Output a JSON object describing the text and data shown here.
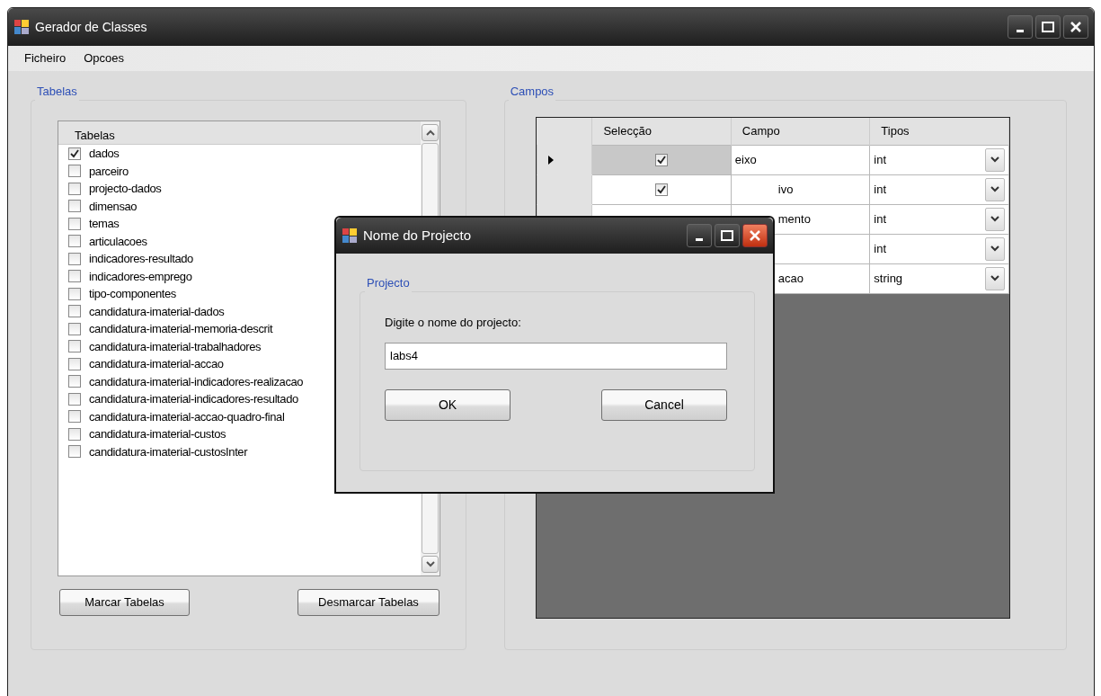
{
  "window": {
    "title": "Gerador de Classes"
  },
  "menu": [
    "Ficheiro",
    "Opcoes"
  ],
  "tables_group": {
    "title": "Tabelas",
    "header": "Tabelas",
    "items": [
      {
        "label": "dados",
        "checked": true
      },
      {
        "label": "parceiro",
        "checked": false
      },
      {
        "label": "projecto-dados",
        "checked": false
      },
      {
        "label": "dimensao",
        "checked": false
      },
      {
        "label": "temas",
        "checked": false
      },
      {
        "label": "articulacoes",
        "checked": false
      },
      {
        "label": "indicadores-resultado",
        "checked": false
      },
      {
        "label": "indicadores-emprego",
        "checked": false
      },
      {
        "label": "tipo-componentes",
        "checked": false
      },
      {
        "label": "candidatura-imaterial-dados",
        "checked": false
      },
      {
        "label": "candidatura-imaterial-memoria-descrit",
        "checked": false
      },
      {
        "label": "candidatura-imaterial-trabalhadores",
        "checked": false
      },
      {
        "label": "candidatura-imaterial-accao",
        "checked": false
      },
      {
        "label": "candidatura-imaterial-indicadores-realizacao",
        "checked": false
      },
      {
        "label": "candidatura-imaterial-indicadores-resultado",
        "checked": false
      },
      {
        "label": "candidatura-imaterial-accao-quadro-final",
        "checked": false
      },
      {
        "label": "candidatura-imaterial-custos",
        "checked": false
      },
      {
        "label": "candidatura-imaterial-custosInter",
        "checked": false
      }
    ],
    "buttons": [
      "Marcar Tabelas",
      "Desmarcar Tabelas"
    ]
  },
  "fields_group": {
    "title": "Campos",
    "columns": [
      "Selecção",
      "Campo",
      "Tipos"
    ],
    "rows": [
      {
        "current": true,
        "checked": true,
        "campo": "eixo",
        "tipo": "int",
        "covered": false
      },
      {
        "current": false,
        "checked": true,
        "campo": "ivo",
        "tipo": "int",
        "covered": true
      },
      {
        "campo": "mento",
        "tipo": "int",
        "covered": true
      },
      {
        "tipo": "int"
      },
      {
        "campo": "acao",
        "tipo": "string",
        "covered": true
      }
    ]
  },
  "dialog": {
    "title": "Nome do Projecto",
    "group_title": "Projecto",
    "prompt": "Digite o nome do projecto:",
    "value": "labs4",
    "buttons": [
      "OK",
      "Cancel"
    ]
  }
}
